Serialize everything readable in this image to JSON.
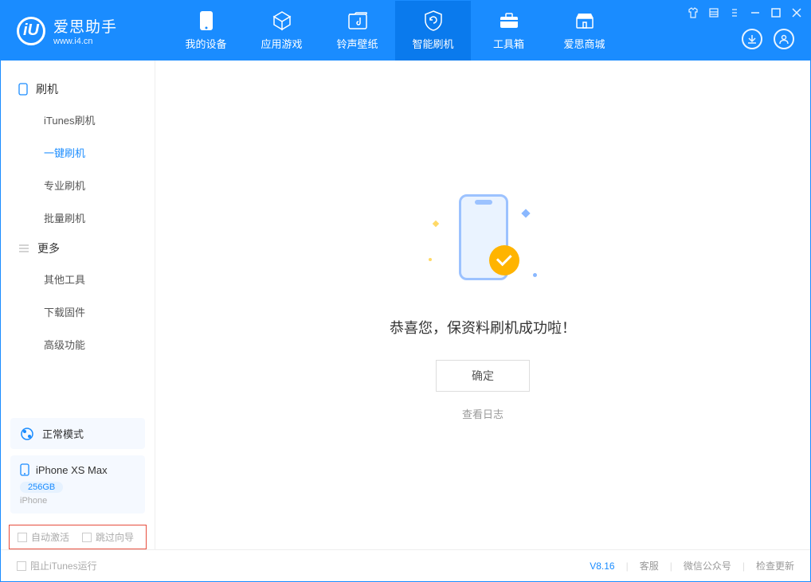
{
  "app": {
    "title": "爱思助手",
    "subtitle": "www.i4.cn"
  },
  "nav": {
    "tabs": [
      {
        "label": "我的设备"
      },
      {
        "label": "应用游戏"
      },
      {
        "label": "铃声壁纸"
      },
      {
        "label": "智能刷机"
      },
      {
        "label": "工具箱"
      },
      {
        "label": "爱思商城"
      }
    ]
  },
  "sidebar": {
    "section1": {
      "title": "刷机",
      "items": [
        "iTunes刷机",
        "一键刷机",
        "专业刷机",
        "批量刷机"
      ]
    },
    "section2": {
      "title": "更多",
      "items": [
        "其他工具",
        "下载固件",
        "高级功能"
      ]
    },
    "mode_label": "正常模式",
    "device": {
      "name": "iPhone XS Max",
      "capacity": "256GB",
      "type": "iPhone"
    },
    "checkboxes": {
      "auto_activate": "自动激活",
      "skip_guide": "跳过向导"
    }
  },
  "main": {
    "success_msg": "恭喜您，保资料刷机成功啦！",
    "ok_btn": "确定",
    "view_log": "查看日志"
  },
  "footer": {
    "block_itunes": "阻止iTunes运行",
    "version": "V8.16",
    "links": [
      "客服",
      "微信公众号",
      "检查更新"
    ]
  }
}
